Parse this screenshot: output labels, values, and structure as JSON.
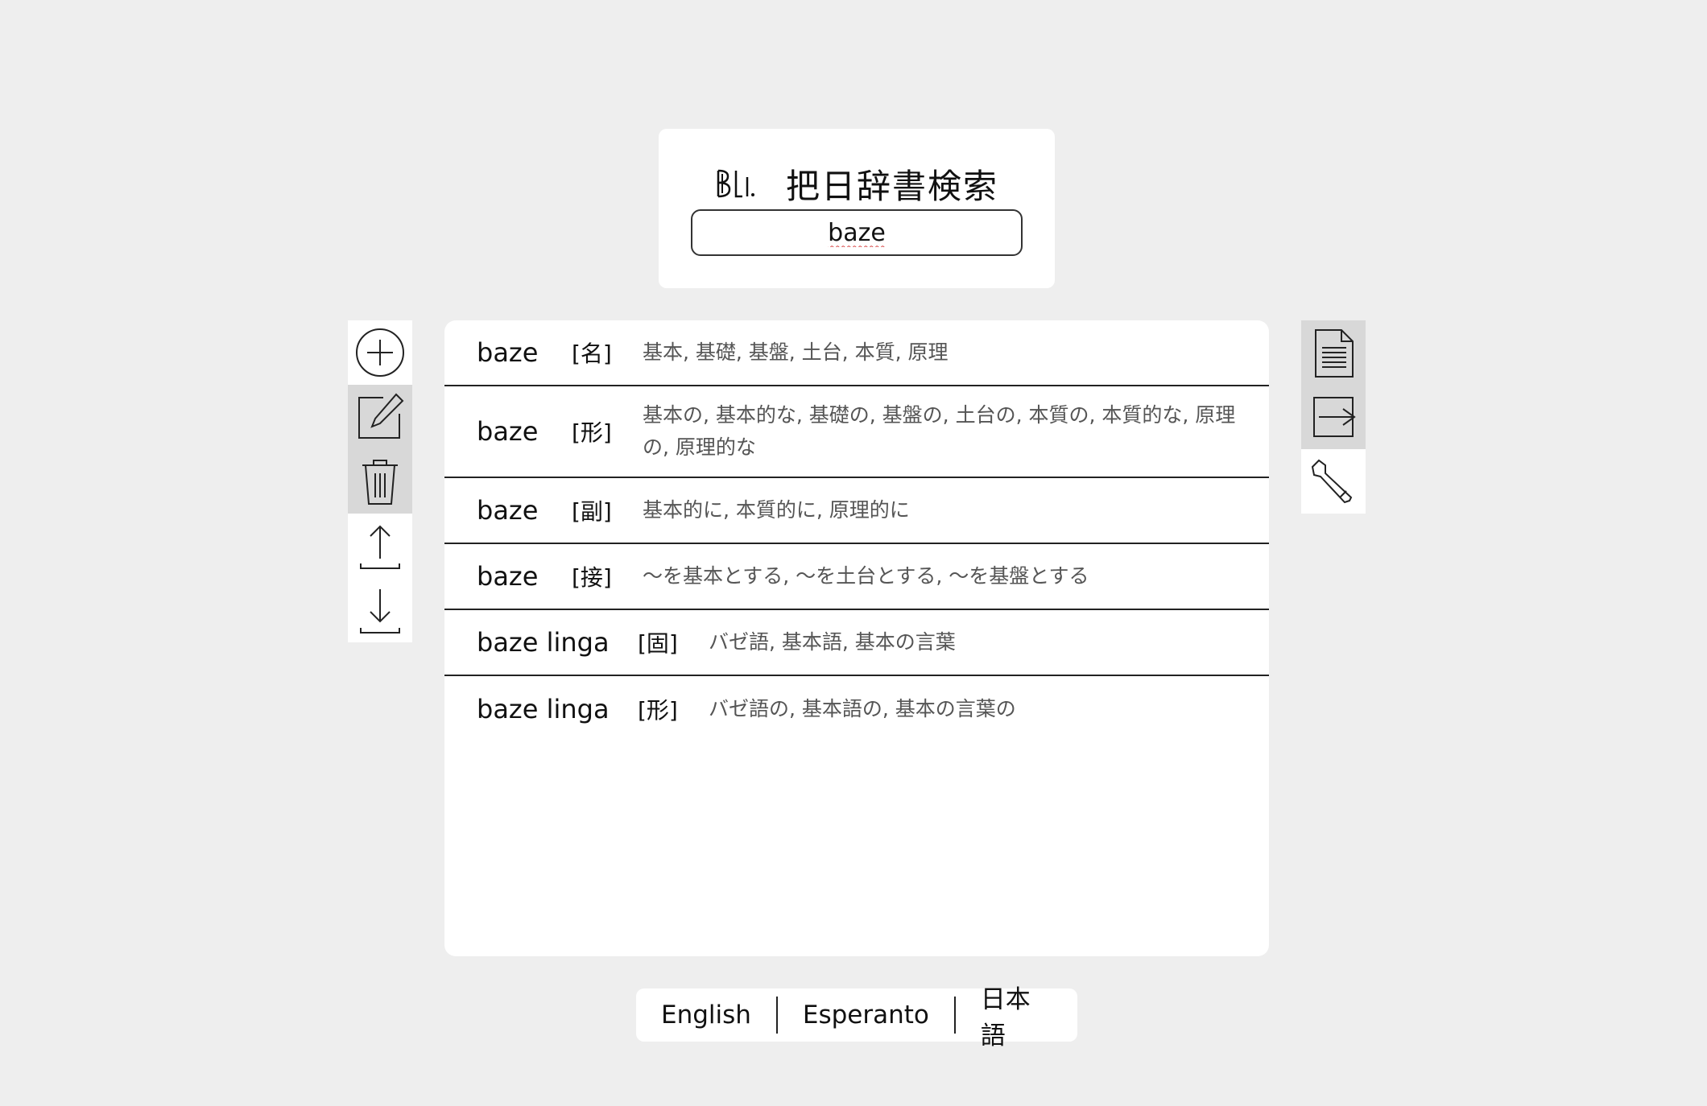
{
  "header": {
    "title": "把日辞書検索",
    "search_value": "baze"
  },
  "left_toolbar": [
    {
      "icon": "plus-circle-icon"
    },
    {
      "icon": "edit-icon"
    },
    {
      "icon": "trash-icon"
    },
    {
      "icon": "upload-icon"
    },
    {
      "icon": "download-icon"
    }
  ],
  "right_toolbar": [
    {
      "icon": "document-icon"
    },
    {
      "icon": "export-icon"
    },
    {
      "icon": "wrench-icon"
    }
  ],
  "results": [
    {
      "word": "baze",
      "pos": "[名]",
      "gloss": "基本, 基礎, 基盤, 土台, 本質, 原理"
    },
    {
      "word": "baze",
      "pos": "[形]",
      "gloss": "基本の, 基本的な, 基礎の, 基盤の, 土台の, 本質の, 本質的な, 原理の, 原理的な"
    },
    {
      "word": "baze",
      "pos": "[副]",
      "gloss": "基本的に, 本質的に, 原理的に"
    },
    {
      "word": "baze",
      "pos": "[接]",
      "gloss": "〜を基本とする, 〜を土台とする, 〜を基盤とする"
    },
    {
      "word": "baze linga",
      "pos": "[固]",
      "gloss": "バゼ語, 基本語, 基本の言葉"
    },
    {
      "word": "baze linga",
      "pos": "[形]",
      "gloss": "バゼ語の, 基本語の, 基本の言葉の"
    }
  ],
  "languages": [
    "English",
    "Esperanto",
    "日本語"
  ],
  "colors": {
    "background": "#eeeeee",
    "panel": "#ffffff",
    "button_active": "#d8d8d8",
    "spellcheck": "#d64545"
  }
}
